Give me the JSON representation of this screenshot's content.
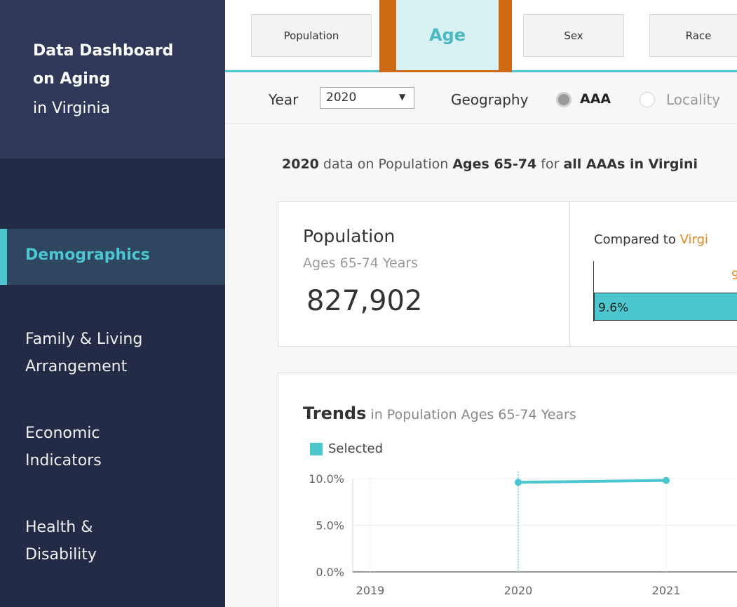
{
  "sidebar": {
    "brand_line1": "Data Dashboard",
    "brand_line2": "on Aging",
    "brand_line3": "in Virginia",
    "active_item": "Demographics",
    "items": [
      {
        "label_line1": "Family & Living",
        "label_line2": "Arrangement"
      },
      {
        "label_line1": "Economic",
        "label_line2": "Indicators"
      },
      {
        "label_line1": "Health &",
        "label_line2": "Disability"
      }
    ]
  },
  "tabs": {
    "population": "Population",
    "age": "Age",
    "sex": "Sex",
    "race": "Race"
  },
  "filters": {
    "year_label": "Year",
    "year_value": "2020",
    "geography_label": "Geography",
    "option_aaa": "AAA",
    "option_locality": "Locality"
  },
  "summary": {
    "year": "2020",
    "text1": " data on Population ",
    "ages": "Ages 65-74",
    "text2": " for ",
    "scope": "all AAAs in Virgini"
  },
  "kpi": {
    "title": "Population",
    "subtitle": "Ages 65-74 Years",
    "value": "827,902"
  },
  "compare": {
    "title_prefix": "Compared to ",
    "title_va": "Virgi",
    "va_value_partial": "9",
    "bar_label": "9.6%"
  },
  "trends": {
    "title_bold": "Trends",
    "title_rest": " in Population Ages 65-74 Years",
    "legend": "Selected"
  },
  "chart_data": {
    "type": "line",
    "x": [
      2020,
      2021
    ],
    "x_ticks": [
      "2019",
      "2020",
      "2021"
    ],
    "y_ticks": [
      "10.0%",
      "5.0%",
      "0.0%"
    ],
    "ylim": [
      0,
      10
    ],
    "series": [
      {
        "name": "Selected",
        "values": [
          9.6,
          9.8
        ],
        "color": "#4cc6cf"
      }
    ],
    "legend_position": "top-left",
    "grid": true
  }
}
